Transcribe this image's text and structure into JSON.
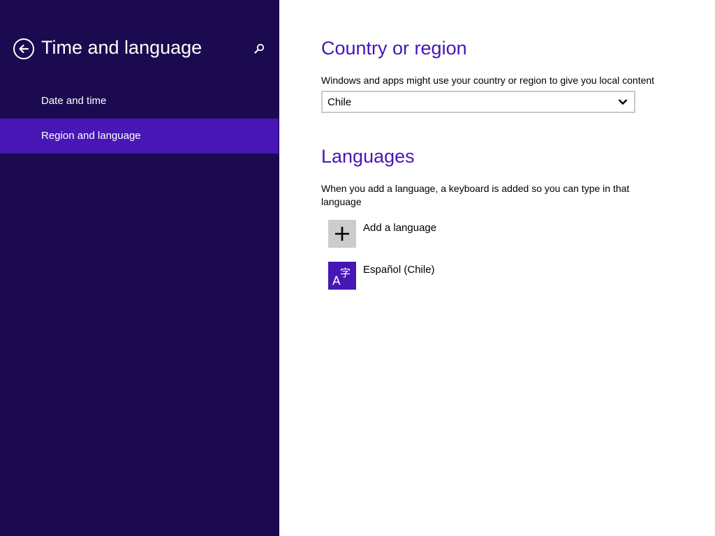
{
  "window": {
    "title": "Time and language"
  },
  "nav": {
    "items": [
      {
        "label": "Date and time",
        "selected": false
      },
      {
        "label": "Region and language",
        "selected": true
      }
    ]
  },
  "country": {
    "heading": "Country or region",
    "description": "Windows and apps might use your country or region to give you local content",
    "selected_value": "Chile"
  },
  "languages": {
    "heading": "Languages",
    "description": "When you add a language, a keyboard is added so you can type in that language",
    "add_label": "Add a language",
    "list": [
      {
        "label": "Español (Chile)"
      }
    ]
  },
  "icons": {
    "back": "back-arrow-icon",
    "search": "search-icon",
    "dropdown": "chevron-down-icon",
    "add": "plus-icon",
    "language": "language-icon",
    "language_glyph_latin": "A",
    "language_glyph_cjk": "字"
  },
  "colors": {
    "nav_background": "#1b0a50",
    "accent": "#4617b4",
    "add_tile": "#cccccc",
    "content_background": "#ffffff"
  }
}
